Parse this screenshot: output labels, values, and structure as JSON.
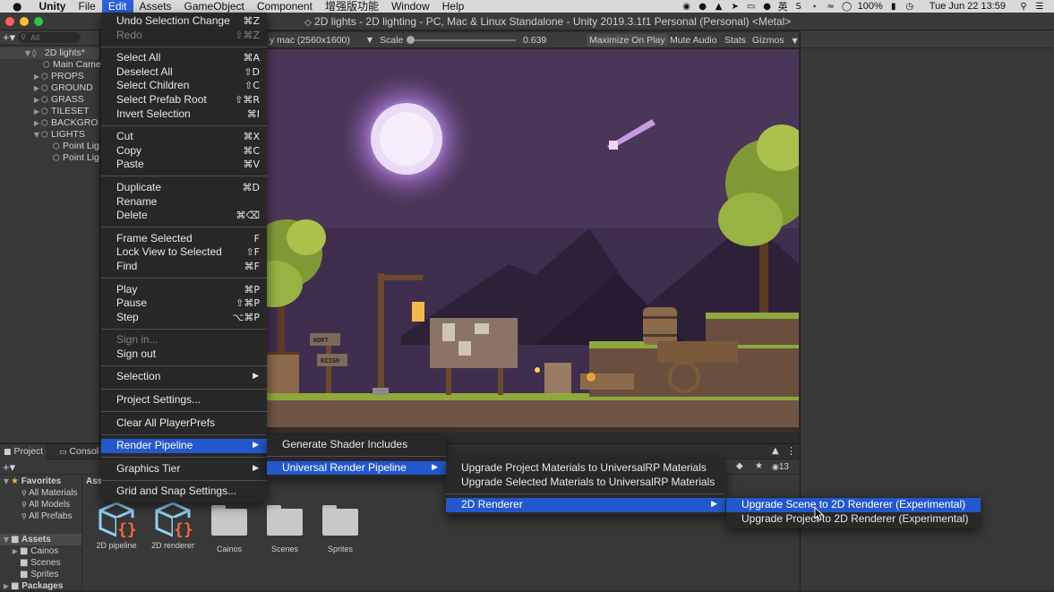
{
  "menubar": {
    "apple": "",
    "items": [
      "Unity",
      "File",
      "Edit",
      "Assets",
      "GameObject",
      "Component",
      "增强版功能",
      "Window",
      "Help"
    ],
    "battery": "100%",
    "clock": "Tue Jun 22  13:59",
    "ime": "英"
  },
  "window": {
    "title": "2D lights - 2D lighting - PC, Mac & Linux Standalone - Unity 2019.3.1f1 Personal (Personal) <Metal>"
  },
  "hierarchy": {
    "search_placeholder": "All",
    "rows": [
      {
        "label": "2D lights*",
        "kind": "scene"
      },
      {
        "label": "Main Came",
        "kind": "child"
      },
      {
        "label": "PROPS",
        "kind": "group"
      },
      {
        "label": "GROUND",
        "kind": "group"
      },
      {
        "label": "GRASS",
        "kind": "group"
      },
      {
        "label": "TILESET",
        "kind": "group"
      },
      {
        "label": "BACKGRO",
        "kind": "group"
      },
      {
        "label": "LIGHTS",
        "kind": "groupopen"
      },
      {
        "label": "Point Lig",
        "kind": "grandchild"
      },
      {
        "label": "Point Lig",
        "kind": "grandchild"
      }
    ]
  },
  "game_toolbar": {
    "resolution": "y mac (2560x1600)",
    "scale_label": "Scale",
    "scale_value": "0.639",
    "maximize": "Maximize On Play",
    "mute": "Mute Audio",
    "stats": "Stats",
    "gizmos": "Gizmos"
  },
  "scene_signs": [
    "WORT",
    "RIIGH"
  ],
  "project": {
    "tabs": [
      "Project",
      "Consol"
    ],
    "assets_header": "Ass",
    "badge_count": "13",
    "favorites_label": "Favorites",
    "favorites": [
      "All Materials",
      "All Models",
      "All Prefabs"
    ],
    "assets_label": "Assets",
    "asset_folders": [
      "Cainos",
      "Scenes",
      "Sprites"
    ],
    "packages_label": "Packages",
    "grid": [
      {
        "label": "2D pipeline",
        "kind": "script"
      },
      {
        "label": "2D renderer",
        "kind": "script"
      },
      {
        "label": "Cainos",
        "kind": "folder"
      },
      {
        "label": "Scenes",
        "kind": "folder"
      },
      {
        "label": "Sprites",
        "kind": "folder"
      }
    ]
  },
  "edit_menu": {
    "undo": {
      "label": "Undo Selection Change",
      "shortcut": "⌘Z"
    },
    "redo": {
      "label": "Redo",
      "shortcut": "⇧⌘Z"
    },
    "select_all": {
      "label": "Select All",
      "shortcut": "⌘A"
    },
    "deselect_all": {
      "label": "Deselect All",
      "shortcut": "⇧D"
    },
    "select_children": {
      "label": "Select Children",
      "shortcut": "⇧C"
    },
    "select_prefab_root": {
      "label": "Select Prefab Root",
      "shortcut": "⇧⌘R"
    },
    "invert_selection": {
      "label": "Invert Selection",
      "shortcut": "⌘I"
    },
    "cut": {
      "label": "Cut",
      "shortcut": "⌘X"
    },
    "copy": {
      "label": "Copy",
      "shortcut": "⌘C"
    },
    "paste": {
      "label": "Paste",
      "shortcut": "⌘V"
    },
    "duplicate": {
      "label": "Duplicate",
      "shortcut": "⌘D"
    },
    "rename": {
      "label": "Rename",
      "shortcut": ""
    },
    "delete": {
      "label": "Delete",
      "shortcut": "⌘⌫"
    },
    "frame_selected": {
      "label": "Frame Selected",
      "shortcut": "F"
    },
    "lock_view": {
      "label": "Lock View to Selected",
      "shortcut": "⇧F"
    },
    "find": {
      "label": "Find",
      "shortcut": "⌘F"
    },
    "play": {
      "label": "Play",
      "shortcut": "⌘P"
    },
    "pause": {
      "label": "Pause",
      "shortcut": "⇧⌘P"
    },
    "step": {
      "label": "Step",
      "shortcut": "⌥⌘P"
    },
    "sign_in": {
      "label": "Sign in..."
    },
    "sign_out": {
      "label": "Sign out"
    },
    "selection": {
      "label": "Selection"
    },
    "project_settings": {
      "label": "Project Settings..."
    },
    "clear_prefs": {
      "label": "Clear All PlayerPrefs"
    },
    "render_pipeline": {
      "label": "Render Pipeline"
    },
    "graphics_tier": {
      "label": "Graphics Tier"
    },
    "grid_snap": {
      "label": "Grid and Snap Settings..."
    }
  },
  "render_pipeline_menu": {
    "generate": "Generate Shader Includes",
    "urp": "Universal Render Pipeline"
  },
  "urp_menu": {
    "upgrade_project": "Upgrade Project Materials to UniversalRP Materials",
    "upgrade_selected": "Upgrade Selected Materials to UniversalRP Materials",
    "renderer2d": "2D Renderer"
  },
  "renderer2d_menu": {
    "upgrade_scene": "Upgrade Scene to 2D Renderer (Experimental)",
    "upgrade_project": "Upgrade Project to 2D Renderer (Experimental)"
  },
  "colors": {
    "highlight": "#2358cc",
    "menubar_active": "#2a62d8",
    "sky": "#4a3658",
    "moon": "#e8d8f4"
  }
}
